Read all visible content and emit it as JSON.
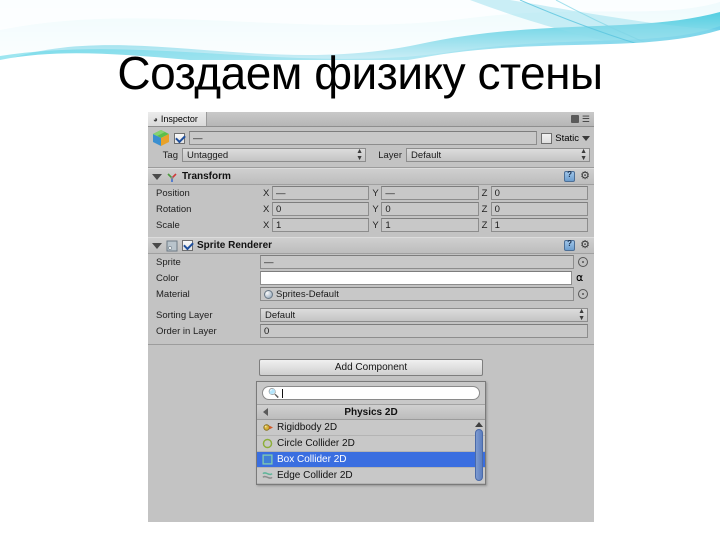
{
  "slide": {
    "title": "Создаем физику стены"
  },
  "colors": {
    "accent_wave": "#2bbfd0",
    "selection_blue": "#3a6ee0",
    "panel_gray": "#c3c3c3"
  },
  "inspector": {
    "tab": {
      "label": "Inspector",
      "icon": "inspector-icon"
    },
    "tab_menu_icon": "lock-icon",
    "tab_options_icon": "options-menu-icon",
    "object": {
      "icon": "gameobject-cube-icon",
      "enabled_checkbox": true,
      "name_value": "—",
      "static_label": "Static",
      "static_checked": false,
      "tag_label": "Tag",
      "tag_value": "Untagged",
      "layer_label": "Layer",
      "layer_value": "Default"
    },
    "components": [
      {
        "name": "Transform",
        "icon": "transform-axis-icon",
        "has_checkbox": false,
        "help_icon": "help-icon",
        "gear_icon": "gear-icon",
        "vectors": [
          {
            "label": "Position",
            "x": "—",
            "y": "—",
            "z": "0"
          },
          {
            "label": "Rotation",
            "x": "0",
            "y": "0",
            "z": "0"
          },
          {
            "label": "Scale",
            "x": "1",
            "y": "1",
            "z": "1"
          }
        ],
        "axis_labels": {
          "x": "X",
          "y": "Y",
          "z": "Z"
        }
      },
      {
        "name": "Sprite Renderer",
        "icon": "sprite-renderer-icon",
        "has_checkbox": true,
        "checked": true,
        "help_icon": "help-icon",
        "gear_icon": "gear-icon",
        "properties": [
          {
            "label": "Sprite",
            "value": "—",
            "control": "object-field"
          },
          {
            "label": "Color",
            "value": "",
            "control": "color-field"
          },
          {
            "label": "Material",
            "value": "Sprites-Default",
            "control": "object-field"
          }
        ],
        "extra_properties": [
          {
            "label": "Sorting Layer",
            "value": "Default",
            "control": "popup"
          },
          {
            "label": "Order in Layer",
            "value": "0",
            "control": "text"
          }
        ]
      }
    ],
    "add_component": {
      "button_label": "Add Component",
      "search": {
        "placeholder": "",
        "value": "",
        "icon": "search-icon"
      },
      "menu_title": "Physics 2D",
      "back_icon": "chevron-left-icon",
      "items": [
        {
          "label": "Rigidbody 2D",
          "icon": "rigidbody-2d-icon",
          "selected": false
        },
        {
          "label": "Circle Collider 2D",
          "icon": "circle-collider-2d-icon",
          "selected": false
        },
        {
          "label": "Box Collider 2D",
          "icon": "box-collider-2d-icon",
          "selected": true
        },
        {
          "label": "Edge Collider 2D",
          "icon": "edge-collider-2d-icon",
          "selected": false
        }
      ],
      "scrollbar": {
        "up_icon": "scroll-up-arrow-icon"
      }
    }
  }
}
